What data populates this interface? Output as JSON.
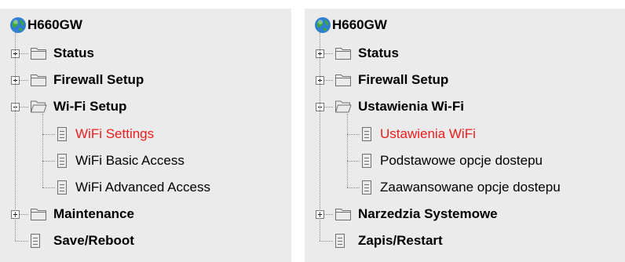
{
  "left": {
    "root": "H660GW",
    "nodes": [
      {
        "label": "Status",
        "type": "folder",
        "state": "collapsed",
        "level": 0
      },
      {
        "label": "Firewall Setup",
        "type": "folder",
        "state": "collapsed",
        "level": 0
      },
      {
        "label": "Wi-Fi Setup",
        "type": "folder",
        "state": "expanded",
        "level": 0
      },
      {
        "label": "WiFi Settings",
        "type": "page",
        "level": 1,
        "selected": true
      },
      {
        "label": "WiFi Basic Access",
        "type": "page",
        "level": 1
      },
      {
        "label": "WiFi Advanced Access",
        "type": "page",
        "level": 1
      },
      {
        "label": "Maintenance",
        "type": "folder",
        "state": "collapsed",
        "level": 0
      },
      {
        "label": "Save/Reboot",
        "type": "page",
        "level": 0
      }
    ]
  },
  "right": {
    "root": "H660GW",
    "nodes": [
      {
        "label": "Status",
        "type": "folder",
        "state": "collapsed",
        "level": 0
      },
      {
        "label": "Firewall Setup",
        "type": "folder",
        "state": "collapsed",
        "level": 0
      },
      {
        "label": "Ustawienia Wi-Fi",
        "type": "folder",
        "state": "expanded",
        "level": 0
      },
      {
        "label": "Ustawienia WiFi",
        "type": "page",
        "level": 1,
        "selected": true
      },
      {
        "label": "Podstawowe opcje dostepu",
        "type": "page",
        "level": 1
      },
      {
        "label": "Zaawansowane opcje dostepu",
        "type": "page",
        "level": 1
      },
      {
        "label": "Narzedzia Systemowe",
        "type": "folder",
        "state": "collapsed",
        "level": 0
      },
      {
        "label": "Zapis/Restart",
        "type": "page",
        "level": 0
      }
    ]
  },
  "colors": {
    "panel_background": "#ebebeb",
    "selected_text": "#ee1c1c",
    "text": "#000000",
    "connector": "#8a8a8a"
  },
  "icons": {
    "root": "globe-icon",
    "folder_collapsed": "folder-icon",
    "folder_expanded": "folder-open-icon",
    "page": "document-icon",
    "expand": "expand-plus-icon",
    "collapse": "collapse-minus-icon"
  }
}
